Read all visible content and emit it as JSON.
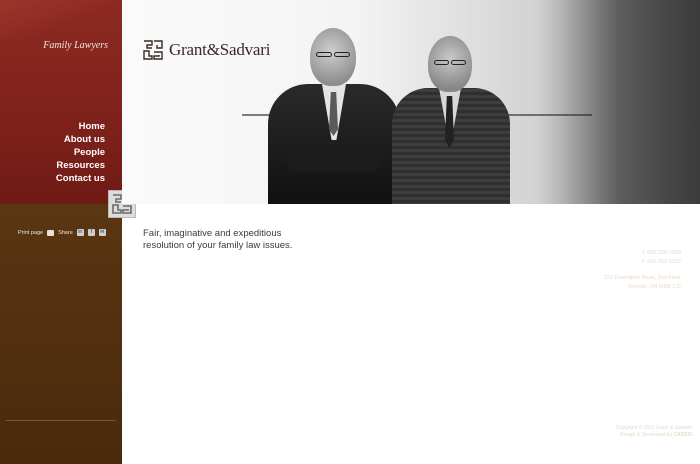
{
  "sidebar": {
    "tagline": "Family Lawyers",
    "nav": [
      {
        "label": "Home"
      },
      {
        "label": "About us"
      },
      {
        "label": "People"
      },
      {
        "label": "Resources"
      },
      {
        "label": "Contact us"
      }
    ],
    "print_label": "Print page",
    "share_label": "Share",
    "share_icons": [
      "linkedin-icon",
      "facebook-icon",
      "email-icon"
    ],
    "phone": "T 416-238-7899",
    "fax": "F 416-352-1522",
    "address_line1": "152 Davenport Road, 2nd Floor",
    "address_line2": "Toronto, ON M5R 1J2",
    "copyright": "Copyright © 2011 Grant & Sadvari.",
    "developed_by_prefix": "Design & Developed by",
    "developer": "CASCO."
  },
  "header": {
    "brand_name": "Grant&Sadvari"
  },
  "main": {
    "intro_line1": "Fair, imaginative and expeditious",
    "intro_line2": "resolution of your family law issues."
  },
  "colors": {
    "sidebar_top": "#8c2a22",
    "sidebar_bottom": "#4a2a0c",
    "text": "#3b3b3b"
  }
}
